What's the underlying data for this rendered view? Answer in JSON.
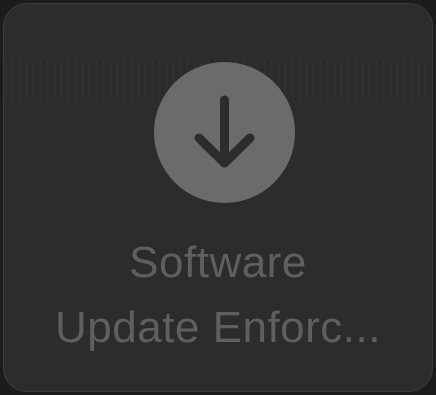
{
  "app_tile": {
    "icon": "download-arrow-icon",
    "label_line1": "Software",
    "label_line2": "Update Enforc...",
    "colors": {
      "background": "#2c2c2c",
      "icon_circle": "#6b6b6b",
      "icon_arrow": "#2c2c2c",
      "label_text": "#5f5f5f"
    }
  }
}
